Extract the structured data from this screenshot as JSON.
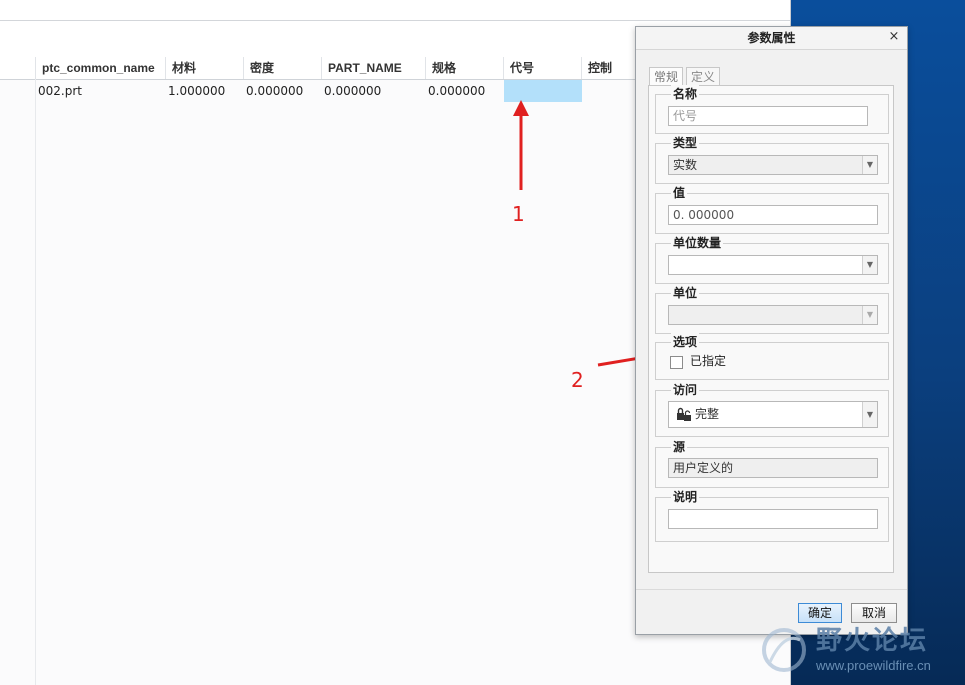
{
  "table": {
    "headers": [
      "ptc_common_name",
      "材料",
      "密度",
      "PART_NAME",
      "规格",
      "代号",
      "控制"
    ],
    "row": [
      "002.prt",
      "1.000000",
      "0.000000",
      "0.000000",
      "0.000000",
      "",
      ""
    ]
  },
  "dialog": {
    "title": "参数属性",
    "close_glyph": "×",
    "tabs": [
      "常规",
      "定义"
    ],
    "name": {
      "label": "名称",
      "value": "代号"
    },
    "type": {
      "label": "类型",
      "value": "实数"
    },
    "value": {
      "label": "值",
      "value": "0. 000000"
    },
    "unit_qty": {
      "label": "单位数量",
      "value": ""
    },
    "unit": {
      "label": "单位",
      "value": ""
    },
    "options": {
      "label": "选项",
      "checkbox_label": "已指定",
      "checked": false
    },
    "access": {
      "label": "访问",
      "value": "完整",
      "icon": "lock-icon"
    },
    "source": {
      "label": "源",
      "value": "用户定义的"
    },
    "description": {
      "label": "说明",
      "value": ""
    },
    "ok_label": "确定",
    "cancel_label": "取消"
  },
  "annotations": {
    "one": "1",
    "two": "2"
  },
  "watermark": {
    "title": "野火论坛",
    "url": "www.proewildfire.cn"
  },
  "colors": {
    "highlight": "#b3e0fa",
    "arrow": "#e02020",
    "desktop": "#0b3f7e"
  }
}
